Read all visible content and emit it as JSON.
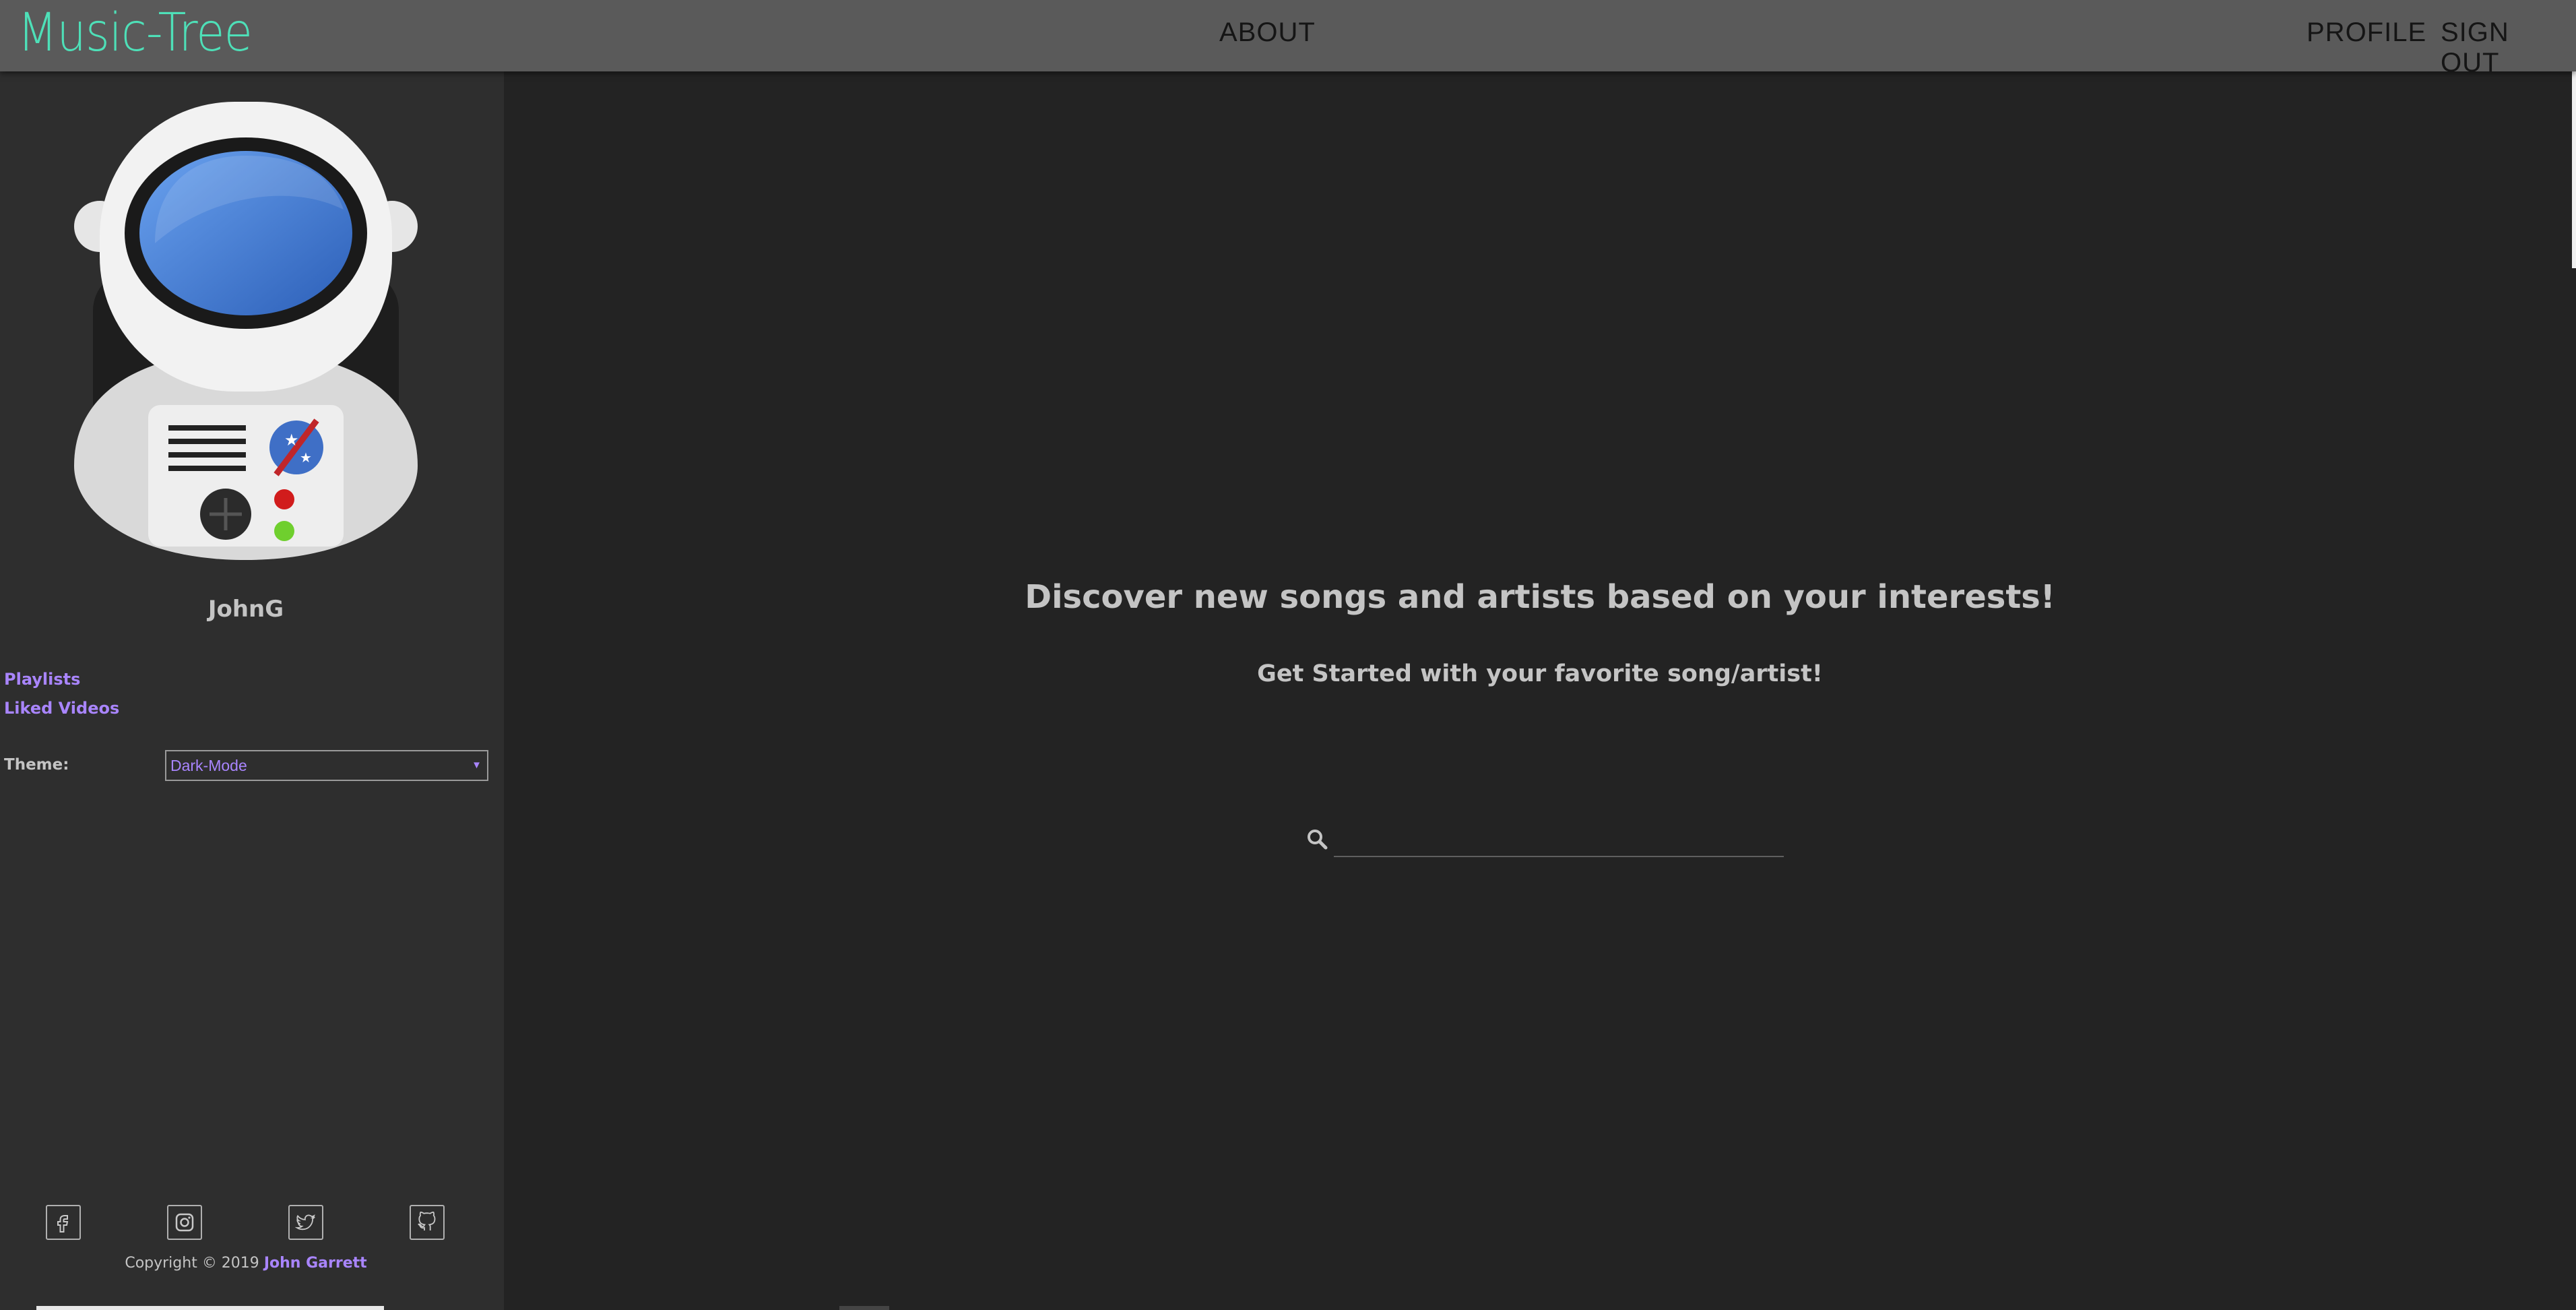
{
  "header": {
    "logo": "Music-Tree",
    "about_label": "ABOUT",
    "profile_label": "PROFILE",
    "signout_label": "SIGN OUT"
  },
  "sidebar": {
    "username": "JohnG",
    "links": [
      "Playlists",
      "Liked Videos"
    ],
    "theme_label": "Theme:",
    "theme_selected": "Dark-Mode",
    "social_icons": [
      "facebook-icon",
      "instagram-icon",
      "twitter-icon",
      "github-icon"
    ],
    "copyright_prefix": "Copyright © 2019",
    "copyright_author": "John Garrett"
  },
  "main": {
    "title": "Discover new songs and artists based on your interests!",
    "subtitle": "Get Started with your favorite song/artist!",
    "search_value": ""
  },
  "colors": {
    "accent": "#a985ff",
    "logo": "#4ee0b8",
    "header_bg": "#5a5a5a",
    "sidebar_bg": "#2e2e2e",
    "main_bg": "#232323",
    "text": "#c4c4c4"
  }
}
